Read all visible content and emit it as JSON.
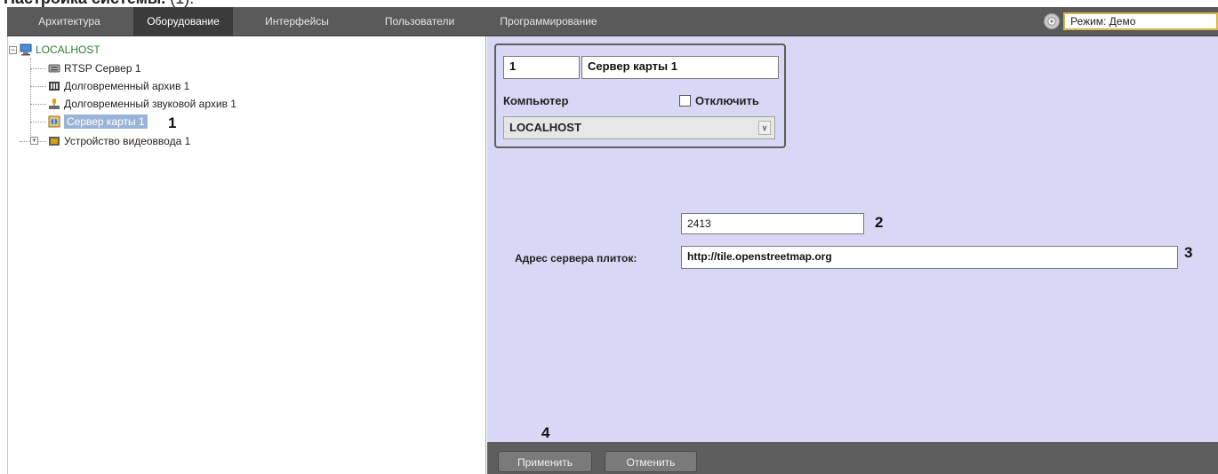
{
  "page_heading": {
    "bold": "Настройка системы.",
    "rest": " (1)."
  },
  "tabs": [
    {
      "label": "Архитектура",
      "active": false
    },
    {
      "label": "Оборудование",
      "active": true
    },
    {
      "label": "Интерфейсы",
      "active": false
    },
    {
      "label": "Пользователи",
      "active": false
    },
    {
      "label": "Программирование",
      "active": false
    }
  ],
  "mode": {
    "icon": "settings-gear-icon",
    "value": "Режим: Демо"
  },
  "tree": {
    "root": {
      "label": "LOCALHOST",
      "icon": "computer-icon",
      "expander": "−"
    },
    "items": [
      {
        "label": "RTSP Сервер 1",
        "icon": "rtsp-server-icon"
      },
      {
        "label": "Долговременный архив 1",
        "icon": "archive-icon"
      },
      {
        "label": "Долговременный звуковой архив 1",
        "icon": "audio-archive-icon"
      },
      {
        "label": "Сервер карты 1",
        "icon": "map-server-icon",
        "selected": true
      },
      {
        "label": "Устройство видеоввода 1",
        "icon": "video-input-icon",
        "expander": "+"
      }
    ]
  },
  "callouts": {
    "c1": "1",
    "c2": "2",
    "c3": "3",
    "c4": "4"
  },
  "object": {
    "id": "1",
    "name": "Сервер карты 1",
    "computer_label": "Компьютер",
    "disable_label": "Отключить",
    "disable_checked": false,
    "computer_value": "LOCALHOST",
    "combo_arrow": "∨"
  },
  "settings": {
    "port_value": "2413",
    "tile_server_label": "Адрес сервера плиток:",
    "tile_server_value": "http://tile.openstreetmap.org"
  },
  "buttons": {
    "apply": "Применить",
    "cancel": "Отменить"
  },
  "colors": {
    "topbar": "#5a5a5a",
    "active_tab": "#3b3b3b",
    "settings_bg": "#d8d8f6",
    "bottombar": "#5e5e5e",
    "selection": "#9ab4d8",
    "root_text": "#2e7d32"
  }
}
